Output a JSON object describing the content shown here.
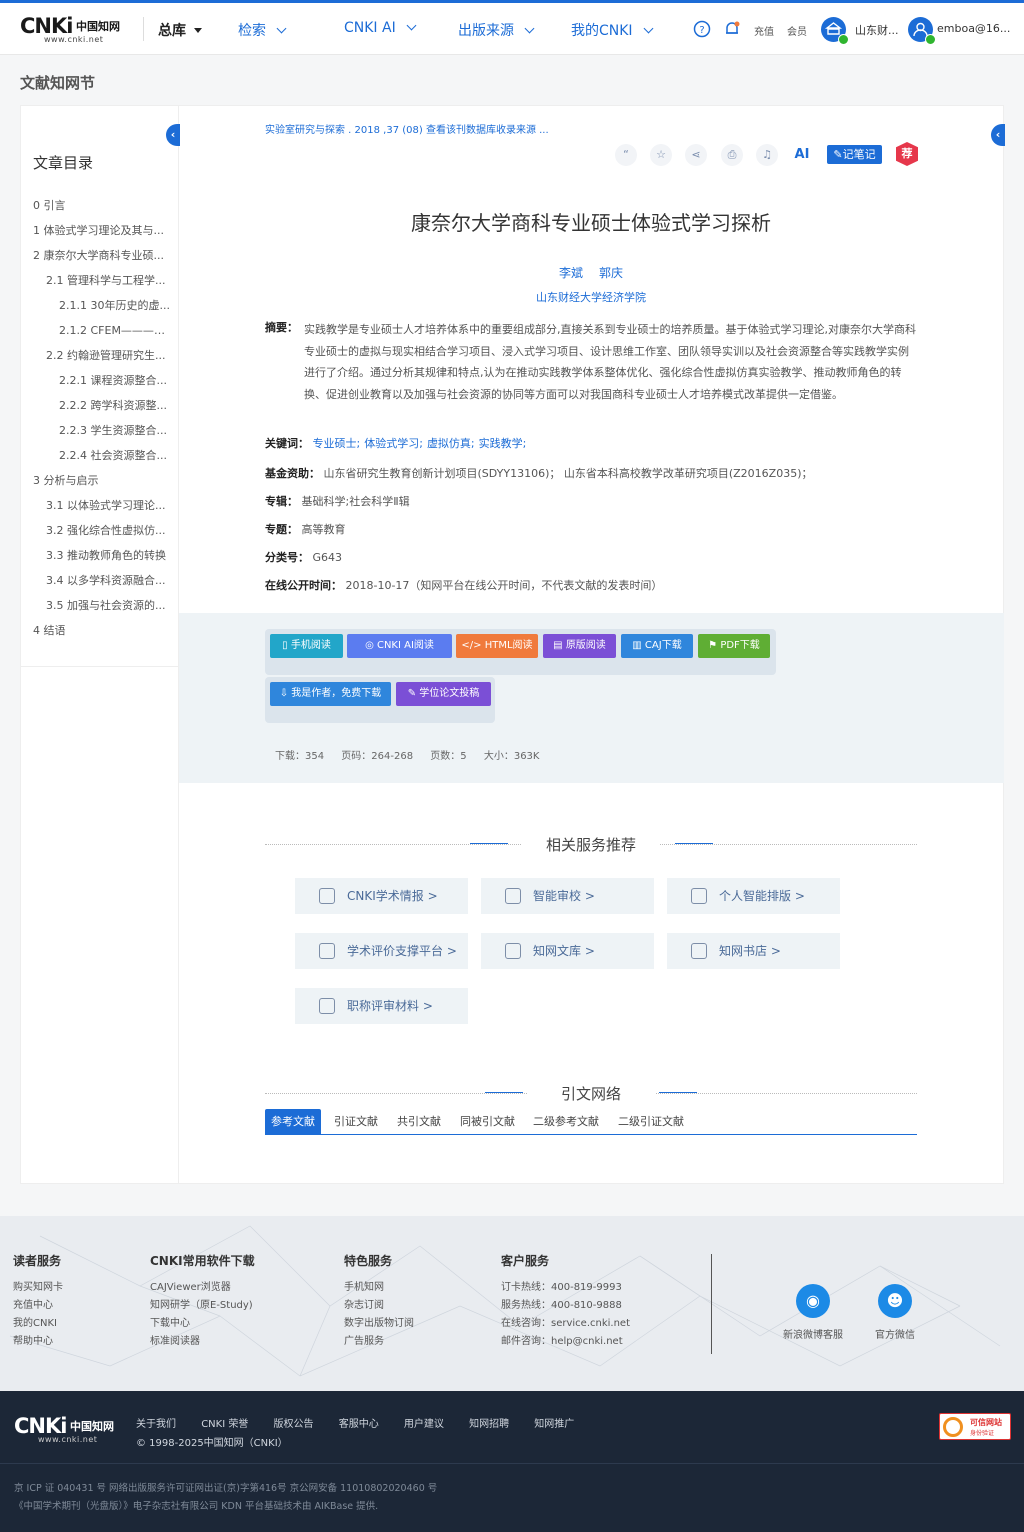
{
  "header": {
    "logo_mark": "CNKi",
    "logo_cn": "中国知网",
    "logo_url": "www.cnki.net",
    "nav": [
      {
        "label": "总库"
      },
      {
        "label": "检索"
      },
      {
        "label": "CNKI AI"
      },
      {
        "label": "出版来源"
      },
      {
        "label": "我的CNKI"
      }
    ],
    "recharge": "充值",
    "member": "会员",
    "institution": "山东财...",
    "user": "emboa@16..."
  },
  "page_title": "文献知网节",
  "toc": {
    "title": "文章目录",
    "items": [
      {
        "label": "0 引言"
      },
      {
        "label": "1 体验式学习理论及其与..."
      },
      {
        "label": "2 康奈尔大学商科专业硕..."
      },
      {
        "label": "2.1 管理科学与工程学..."
      },
      {
        "label": "2.1.1 30年历史的虚..."
      },
      {
        "label": "2.1.2 CFEM————..."
      },
      {
        "label": "2.2 约翰逊管理研究生..."
      },
      {
        "label": "2.2.1 课程资源整合..."
      },
      {
        "label": "2.2.2 跨学科资源整..."
      },
      {
        "label": "2.2.3 学生资源整合..."
      },
      {
        "label": "2.2.4 社会资源整合..."
      },
      {
        "label": "3 分析与启示"
      },
      {
        "label": "3.1 以体验式学习理论..."
      },
      {
        "label": "3.2 强化综合性虚拟仿..."
      },
      {
        "label": "3.3 推动教师角色的转换"
      },
      {
        "label": "3.4 以多学科资源融合..."
      },
      {
        "label": "3.5 加强与社会资源的..."
      },
      {
        "label": "4 结语"
      }
    ]
  },
  "article": {
    "source": "实验室研究与探索 . 2018 ,37 (08)   查看该刊数据库收录来源   ...",
    "note_btn": "记笔记",
    "rec_badge": "荐",
    "ai_label": "AI",
    "title": "康奈尔大学商科专业硕士体验式学习探析",
    "authors": [
      "李斌",
      "郭庆"
    ],
    "org": "山东财经大学经济学院",
    "abstract_label": "摘要：",
    "abstract": "实践教学是专业硕士人才培养体系中的重要组成部分,直接关系到专业硕士的培养质量。基于体验式学习理论,对康奈尔大学商科专业硕士的虚拟与现实相结合学习项目、浸入式学习项目、设计思维工作室、团队领导实训以及社会资源整合等实践教学实例进行了介绍。通过分析其规律和特点,认为在推动实践教学体系整体优化、强化综合性虚拟仿真实验教学、推动教师角色的转换、促进创业教育以及加强与社会资源的协同等方面可以对我国商科专业硕士人才培养模式改革提供一定借鉴。",
    "keywords_label": "关键词：",
    "keywords": [
      "专业硕士;",
      "体验式学习;",
      "虚拟仿真;",
      "实践教学;"
    ],
    "fund_label": "基金资助：",
    "fund": "山东省研究生教育创新计划项目(SDYY13106)； 山东省本科高校教学改革研究项目(Z2016Z035)；",
    "series_label": "专辑：",
    "series": "基础科学;社会科学Ⅱ辑",
    "topic_label": "专题：",
    "topic": "高等教育",
    "class_label": "分类号：",
    "class": "G643",
    "pubtime_label": "在线公开时间：",
    "pubtime": "2018-10-17（知网平台在线公开时间，不代表文献的发表时间）"
  },
  "downloads": {
    "buttons": [
      {
        "label": "手机阅读",
        "color": "#22a6c9"
      },
      {
        "label": "CNKI AI阅读",
        "color": "#5b7cf0"
      },
      {
        "label": "HTML阅读",
        "color": "#f07a3c"
      },
      {
        "label": "原版阅读",
        "color": "#7b4fd6"
      },
      {
        "label": "CAJ下载",
        "color": "#2f86dc"
      },
      {
        "label": "PDF下载",
        "color": "#5fae34"
      }
    ],
    "author_btn": "我是作者，免费下载",
    "thesis_btn": "学位论文投稿",
    "stats": {
      "downloads": "下载：354",
      "pages": "页码：264-268",
      "page_count": "页数：5",
      "size": "大小：363K"
    }
  },
  "services": {
    "title": "相关服务推荐",
    "items": [
      {
        "label": "CNKI学术情报 >",
        "icon": "mortarboard-icon"
      },
      {
        "label": "智能审校 >",
        "icon": "book-icon"
      },
      {
        "label": "个人智能排版 >",
        "icon": "layout-icon"
      },
      {
        "label": "学术评价支撑平台 >",
        "icon": "graduation-icon"
      },
      {
        "label": "知网文库 >",
        "icon": "library-icon"
      },
      {
        "label": "知网书店 >",
        "icon": "bookstore-icon"
      },
      {
        "label": "职称评审材料 >",
        "icon": "certificate-icon"
      }
    ]
  },
  "citation": {
    "title": "引文网络",
    "tabs": [
      {
        "label": "参考文献"
      },
      {
        "label": "引证文献"
      },
      {
        "label": "共引文献"
      },
      {
        "label": "同被引文献"
      },
      {
        "label": "二级参考文献"
      },
      {
        "label": "二级引证文献"
      }
    ]
  },
  "footer": {
    "cols": [
      {
        "title": "读者服务",
        "links": [
          "购买知网卡",
          "充值中心",
          "我的CNKI",
          "帮助中心"
        ]
      },
      {
        "title": "CNKI常用软件下载",
        "links": [
          "CAJViewer浏览器",
          "知网研学（原E-Study)",
          "下载中心",
          "标准阅读器"
        ]
      },
      {
        "title": "特色服务",
        "links": [
          "手机知网",
          "杂志订阅",
          "数字出版物订阅",
          "广告服务"
        ]
      },
      {
        "title": "客户服务",
        "links": [
          "订卡热线：400-819-9993",
          "服务热线：400-810-9888",
          "在线咨询：service.cnki.net",
          "邮件咨询：help@cnki.net"
        ]
      }
    ],
    "weibo": "新浪微博客服",
    "wechat": "官方微信",
    "links": [
      "关于我们",
      "CNKI 荣誉",
      "版权公告",
      "客服中心",
      "用户建议",
      "知网招聘",
      "知网推广"
    ],
    "copyright": "© 1998-2025中国知网（CNKI）",
    "icp": "京 ICP 证 040431 号  网络出版服务许可证网出证(京)字第416号  京公网安备 11010802020460 号",
    "icp2": "《中国学术期刊（光盘版）》电子杂志社有限公司  KDN 平台基础技术由 AIKBase 提供.",
    "trust1": "可信网站",
    "trust2": "身份验证"
  }
}
